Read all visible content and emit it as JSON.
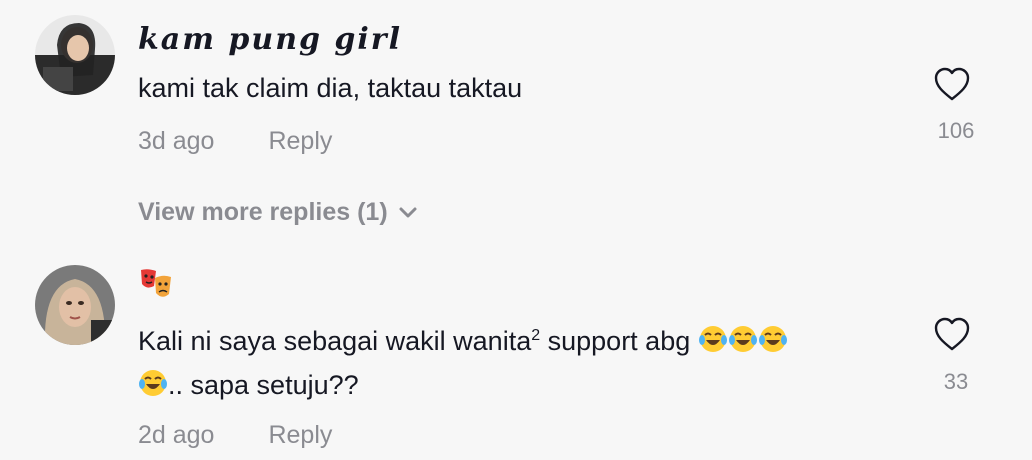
{
  "comments": [
    {
      "username": "kam pung girl",
      "text": "kami tak claim dia, taktau taktau",
      "time": "3d ago",
      "reply_label": "Reply",
      "likes": "106"
    },
    {
      "username_icon": "performing-arts-masks-icon",
      "text_main": "Kali ni saya sebagai wakil wanita",
      "text_sup": "2",
      "text_after": " support abg",
      "text_line2": ".. sapa setuju??",
      "time": "2d ago",
      "reply_label": "Reply",
      "likes": "33"
    }
  ],
  "view_more": "View more replies (1)",
  "icons": {
    "heart": "heart-outline-icon",
    "chevron": "chevron-down-icon",
    "emoji": "face-with-tears-of-joy-emoji"
  },
  "colors": {
    "background": "#f7f7f7",
    "text": "#161823",
    "muted": "#8a8b91"
  }
}
